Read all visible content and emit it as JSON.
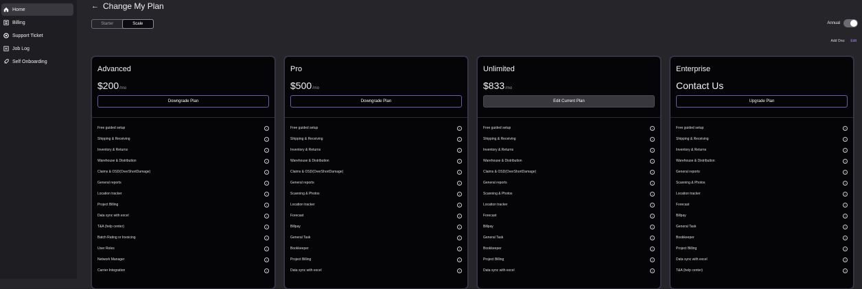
{
  "sidebar": {
    "items": [
      {
        "label": "Home",
        "icon": "home-icon",
        "active": true
      },
      {
        "label": "Billing",
        "icon": "billing-icon"
      },
      {
        "label": "Support Ticket",
        "icon": "support-icon"
      },
      {
        "label": "Job Log",
        "icon": "log-icon"
      },
      {
        "label": "Self Onboarding",
        "icon": "rocket-icon"
      }
    ]
  },
  "header": {
    "back_icon": "arrow-left-icon",
    "title": "Change My Plan"
  },
  "segment": {
    "starter": "Starter",
    "scale": "Scale",
    "selected": "Scale"
  },
  "annual": {
    "label": "Annual",
    "on": true
  },
  "addons": {
    "label": "Add Ons:",
    "edit": "Edit"
  },
  "colors": {
    "accent": "#b58cff",
    "cardBorder": "#3a3a48"
  },
  "plans": [
    {
      "name": "Advanced",
      "price": "$200",
      "per": "/mo",
      "button": "Downgrade Plan",
      "current": false,
      "features": [
        "Free guided setup",
        "Shipping & Receiving",
        "Inventory & Returns",
        "Warehouse & Distribution",
        "Claims & OSD(OverShortDamage)",
        "General reports",
        "Location tracker",
        "Project Billing",
        "Data sync with excel",
        "T&A (help center)",
        "Batch Rating or Invoicing",
        "User Roles",
        "Network Manager",
        "Carrier Integration"
      ]
    },
    {
      "name": "Pro",
      "price": "$500",
      "per": "/mo",
      "button": "Downgrade Plan",
      "current": false,
      "features": [
        "Free guided setup",
        "Shipping & Receiving",
        "Inventory & Returns",
        "Warehouse & Distribution",
        "Claims & OSD(OverShortDamage)",
        "General reports",
        "Scanning & Photos",
        "Location tracker",
        "Forecast",
        "Billpay",
        "General Task",
        "Bookkeeper",
        "Project Billing",
        "Data sync with excel"
      ]
    },
    {
      "name": "Unlimited",
      "price": "$833",
      "per": "/mo",
      "button": "Edit Current Plan",
      "current": true,
      "features": [
        "Free guided setup",
        "Shipping & Receiving",
        "Inventory & Returns",
        "Warehouse & Distribution",
        "Claims & OSD(OverShortDamage)",
        "General reports",
        "Scanning & Photos",
        "Location tracker",
        "Forecast",
        "Billpay",
        "General Task",
        "Bookkeeper",
        "Project Billing",
        "Data sync with excel"
      ]
    },
    {
      "name": "Enterprise",
      "price": "Contact Us",
      "per": "",
      "button": "Upgrade Plan",
      "current": false,
      "features": [
        "Free guided setup",
        "Shipping & Receiving",
        "Inventory & Returns",
        "Warehouse & Distribution",
        "General reports",
        "Scanning & Photos",
        "Location tracker",
        "Forecast",
        "Billpay",
        "General Task",
        "Bookkeeper",
        "Project Billing",
        "Data sync with excel",
        "T&A (help center)"
      ]
    }
  ]
}
